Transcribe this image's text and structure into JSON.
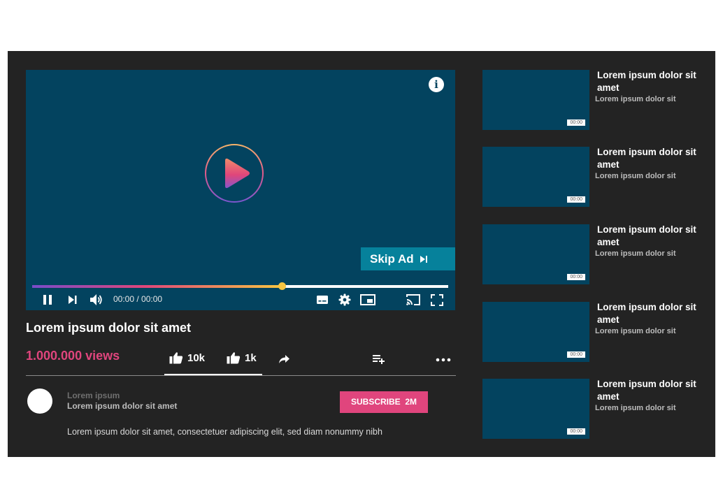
{
  "player": {
    "skip_ad_label": "Skip Ad",
    "time_display": "00:00 / 00:00",
    "progress_fraction": 0.6,
    "icons": [
      "info-icon",
      "play-icon",
      "pause-icon",
      "next-icon",
      "volume-icon",
      "captions-icon",
      "settings-icon",
      "miniplayer-icon",
      "cast-icon",
      "fullscreen-icon",
      "skip-icon"
    ],
    "accent_gradient": [
      "#7a4cc9",
      "#e0467a",
      "#f7c542"
    ]
  },
  "video": {
    "title": "Lorem ipsum dolor sit amet",
    "views": "1.000.000 views",
    "like_count": "10k",
    "dislike_count": "1k"
  },
  "channel": {
    "name": "Lorem ipsum",
    "subtitle": "Lorem ipsum dolor sit amet",
    "subscribe_label": "SUBSCRIBE",
    "subscriber_count": "2M",
    "description": "Lorem ipsum dolor sit amet, consectetuer adipiscing elit, sed diam nonummy nibh"
  },
  "recommendations": [
    {
      "title": "Lorem ipsum dolor sit amet",
      "subtitle": "Lorem ipsum dolor sit",
      "duration": "00:00"
    },
    {
      "title": "Lorem ipsum dolor sit amet",
      "subtitle": "Lorem ipsum dolor sit",
      "duration": "00:00"
    },
    {
      "title": "Lorem ipsum dolor sit amet",
      "subtitle": "Lorem ipsum dolor sit",
      "duration": "00:00"
    },
    {
      "title": "Lorem ipsum dolor sit amet",
      "subtitle": "Lorem ipsum dolor sit",
      "duration": "00:00"
    },
    {
      "title": "Lorem ipsum dolor sit amet",
      "subtitle": "Lorem ipsum dolor sit",
      "duration": "00:00"
    }
  ],
  "colors": {
    "background": "#232323",
    "player": "#03435f",
    "accent_pink": "#e0457d",
    "skip_button": "#06819b"
  }
}
